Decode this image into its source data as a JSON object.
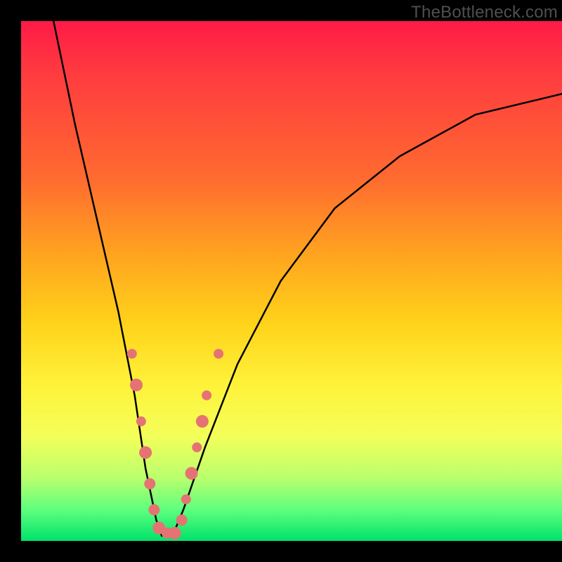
{
  "watermark": "TheBottleneck.com",
  "chart_data": {
    "type": "line",
    "title": "",
    "xlabel": "",
    "ylabel": "",
    "xlim": [
      0,
      100
    ],
    "ylim": [
      0,
      100
    ],
    "v_curve": {
      "name": "bottleneck-curve",
      "minimum_x": 26,
      "left_top_x": 6,
      "right_top_x": 100,
      "right_top_y": 14,
      "approx_points": [
        {
          "x": 6,
          "y": 100
        },
        {
          "x": 10,
          "y": 80
        },
        {
          "x": 14,
          "y": 62
        },
        {
          "x": 18,
          "y": 44
        },
        {
          "x": 21,
          "y": 28
        },
        {
          "x": 23,
          "y": 14
        },
        {
          "x": 25,
          "y": 4
        },
        {
          "x": 26,
          "y": 1
        },
        {
          "x": 28,
          "y": 1
        },
        {
          "x": 30,
          "y": 6
        },
        {
          "x": 34,
          "y": 18
        },
        {
          "x": 40,
          "y": 34
        },
        {
          "x": 48,
          "y": 50
        },
        {
          "x": 58,
          "y": 64
        },
        {
          "x": 70,
          "y": 74
        },
        {
          "x": 84,
          "y": 82
        },
        {
          "x": 100,
          "y": 86
        }
      ]
    },
    "markers": {
      "name": "sample-dots",
      "color": "#e57373",
      "points": [
        {
          "x": 20.5,
          "y": 36,
          "r": 7
        },
        {
          "x": 21.3,
          "y": 30,
          "r": 9
        },
        {
          "x": 22.2,
          "y": 23,
          "r": 7
        },
        {
          "x": 23.0,
          "y": 17,
          "r": 9
        },
        {
          "x": 23.8,
          "y": 11,
          "r": 8
        },
        {
          "x": 24.6,
          "y": 6,
          "r": 8
        },
        {
          "x": 25.5,
          "y": 2.5,
          "r": 9
        },
        {
          "x": 27.0,
          "y": 1.5,
          "r": 8
        },
        {
          "x": 28.4,
          "y": 1.5,
          "r": 9
        },
        {
          "x": 29.7,
          "y": 4,
          "r": 8
        },
        {
          "x": 30.5,
          "y": 8,
          "r": 7
        },
        {
          "x": 31.5,
          "y": 13,
          "r": 9
        },
        {
          "x": 32.5,
          "y": 18,
          "r": 7
        },
        {
          "x": 33.5,
          "y": 23,
          "r": 9
        },
        {
          "x": 34.3,
          "y": 28,
          "r": 7
        },
        {
          "x": 36.5,
          "y": 36,
          "r": 7
        }
      ]
    }
  }
}
